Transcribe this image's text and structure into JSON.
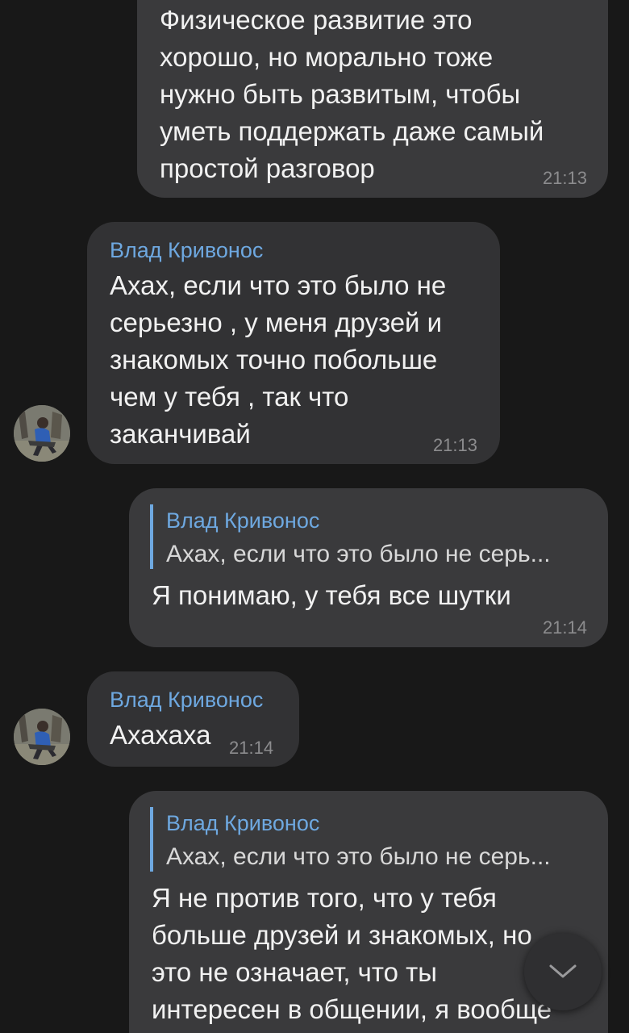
{
  "colors": {
    "background": "#181818",
    "bubble_outgoing": "#3a3a3c",
    "bubble_incoming": "#323234",
    "sender_name": "#6ea8e0",
    "timestamp": "#8c8c8e"
  },
  "messages": [
    {
      "direction": "outgoing",
      "text": "Физическое развитие это\nхорошо, но морально тоже\nнужно быть развитым, чтобы\nуметь поддержать даже   самый\nпростой разговор",
      "time": "21:13"
    },
    {
      "direction": "incoming",
      "sender": "Влад Кривонос",
      "text": "Ахах, если что это было не\nсерьезно , у меня друзей и\nзнакомых точно побольше\nчем у тебя , так что\nзаканчивай",
      "time": "21:13"
    },
    {
      "direction": "outgoing",
      "reply": {
        "name": "Влад Кривонос",
        "text": "Ахах, если что это было не серь..."
      },
      "text": "Я понимаю, у тебя все шутки",
      "time": "21:14"
    },
    {
      "direction": "incoming",
      "sender": "Влад Кривонос",
      "text": "Ахахаха",
      "time": "21:14"
    },
    {
      "direction": "outgoing",
      "reply": {
        "name": "Влад Кривонос",
        "text": "Ахах, если что это было не серь..."
      },
      "text": "Я не против того, что у тебя\nбольше друзей и знакомых, но\nэто не означает, что ты\nинтересен в общении, я вообще"
    }
  ],
  "scroll_button": {
    "icon": "chevron-down-icon"
  }
}
